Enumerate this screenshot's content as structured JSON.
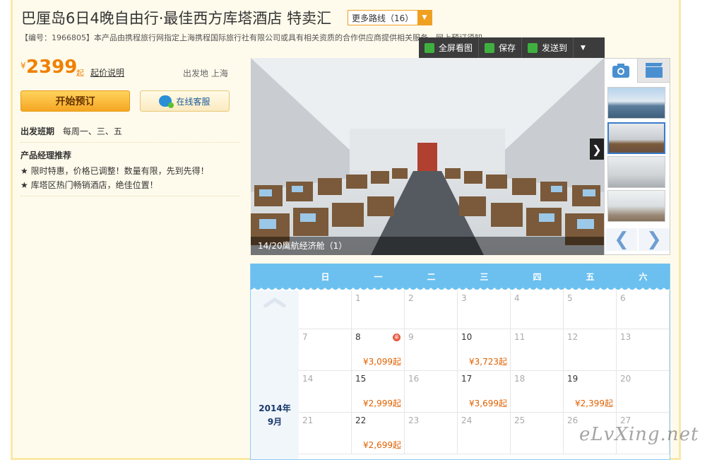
{
  "header": {
    "title": "巴厘岛6日4晚自由行·最佳西方库塔酒店 特卖汇",
    "routes_label": "更多路线（16）",
    "code_line": "【编号：1966805】本产品由携程旅行网指定上海携程国际旅行社有限公司或具有相关资质的合作供应商提供相关服务，网上预订须知"
  },
  "toolbar": {
    "fullscreen": "全屏看图",
    "save": "保存",
    "send": "发送到"
  },
  "pricing": {
    "currency": "¥",
    "amount": "2399",
    "qi": "起",
    "link": "起价说明",
    "depart": "出发地 上海"
  },
  "actions": {
    "book": "开始预订",
    "service": "在线客服"
  },
  "schedule": {
    "label": "出发班期",
    "value": "每周一、三、五"
  },
  "recommend": {
    "title": "产品经理推荐",
    "items": [
      "★ 限时特惠，价格已调整！数量有限，先到先得！",
      "★ 库塔区热门畅销酒店，绝佳位置！"
    ]
  },
  "gallery": {
    "caption": "14/20鹰航经济舱（1）",
    "colors": {
      "sky": "#9cc8e8",
      "cabin": "#dfe3e6",
      "seat": "#7a5a3a"
    }
  },
  "calendar": {
    "weekdays": [
      "日",
      "一",
      "二",
      "三",
      "四",
      "五",
      "六"
    ],
    "year_month": [
      "2014年",
      "9月"
    ],
    "weeks": [
      [
        {
          "d": "",
          "p": ""
        },
        {
          "d": "1",
          "p": ""
        },
        {
          "d": "2",
          "p": ""
        },
        {
          "d": "3",
          "p": ""
        },
        {
          "d": "4",
          "p": ""
        },
        {
          "d": "5",
          "p": ""
        },
        {
          "d": "6",
          "p": ""
        }
      ],
      [
        {
          "d": "7",
          "p": ""
        },
        {
          "d": "8",
          "p": "¥3,099起",
          "badge": "亲"
        },
        {
          "d": "9",
          "p": ""
        },
        {
          "d": "10",
          "p": "¥3,723起"
        },
        {
          "d": "11",
          "p": ""
        },
        {
          "d": "12",
          "p": ""
        },
        {
          "d": "13",
          "p": ""
        }
      ],
      [
        {
          "d": "14",
          "p": ""
        },
        {
          "d": "15",
          "p": "¥2,999起"
        },
        {
          "d": "16",
          "p": ""
        },
        {
          "d": "17",
          "p": "¥3,699起"
        },
        {
          "d": "18",
          "p": ""
        },
        {
          "d": "19",
          "p": "¥2,399起"
        },
        {
          "d": "20",
          "p": ""
        }
      ],
      [
        {
          "d": "21",
          "p": ""
        },
        {
          "d": "22",
          "p": "¥2,699起"
        },
        {
          "d": "23",
          "p": ""
        },
        {
          "d": "24",
          "p": ""
        },
        {
          "d": "25",
          "p": ""
        },
        {
          "d": "26",
          "p": ""
        },
        {
          "d": "27",
          "p": ""
        }
      ]
    ]
  },
  "watermark": "eLvXing.net",
  "accent_colors": {
    "orange": "#f08000",
    "blue": "#6cc0ef"
  }
}
